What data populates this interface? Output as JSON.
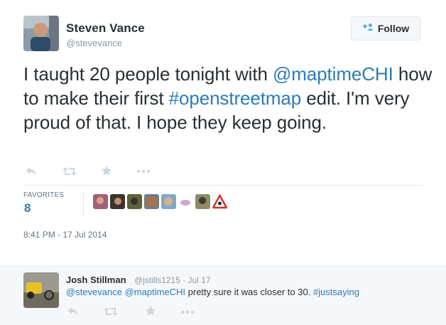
{
  "tweet": {
    "author_name": "Steven Vance",
    "author_handle": "@stevevance",
    "follow_label": "Follow",
    "text_segments": {
      "t1": "I taught 20 people tonight with ",
      "m1": "@maptimeCHI",
      "t2": " how to make their first ",
      "h1": "#openstreetmap",
      "t3": " edit. I'm very proud of that. I hope they keep going."
    },
    "favorites_label": "FAVORITES",
    "favorites_count": "8",
    "timestamp": "8:41 PM - 17 Jul 2014"
  },
  "reply": {
    "author_name": "Josh Stillman",
    "meta": "@jstills1215 · Jul 17",
    "mention1": "@stevevance",
    "mention2": "@maptimeCHI",
    "body": " pretty sure it was closer to 30. ",
    "hashtag": "#justsaying"
  },
  "icons": {
    "reply": "reply-arrow-icon",
    "retweet": "retweet-icon",
    "favorite": "star-icon",
    "more": "more-dots-icon",
    "follow": "add-user-icon"
  },
  "colors": {
    "link": "#2b7bb9",
    "text": "#292f33",
    "muted": "#8899a6",
    "icon": "#ccd6dd"
  }
}
